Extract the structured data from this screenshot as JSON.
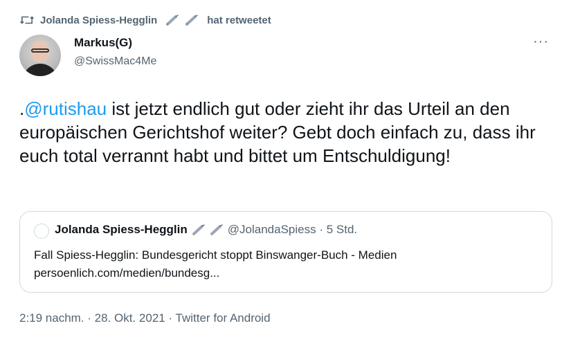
{
  "retweet": {
    "name": "Jolanda Spiess-Hegglin",
    "suffix": "hat retweetet"
  },
  "author": {
    "name": "Markus(G)",
    "handle": "@SwissMac4Me"
  },
  "tweet": {
    "prefix": ".",
    "mention": "@rutishau",
    "text": " ist jetzt endlich gut oder zieht ihr das Urteil an den europäischen Gerichtshof weiter? Gebt doch einfach zu, dass ihr euch total verrannt habt und bittet um Entschuldigung!"
  },
  "quote": {
    "name": "Jolanda Spiess-Hegglin",
    "handle_time": "@JolandaSpiess · 5 Std.",
    "line1": "Fall Spiess-Hegglin: Bundesgericht stoppt Binswanger-Buch - Medien",
    "line2": "persoenlich.com/medien/bundesg..."
  },
  "meta": {
    "timestamp": "2:19 nachm. · 28. Okt. 2021 · Twitter for Android"
  },
  "colors": {
    "accent": "#1d9bf0",
    "secondary_text": "#536471",
    "border": "#cfd9de"
  },
  "icons": [
    "retweet-icon",
    "syringe-icon",
    "more-icon"
  ]
}
